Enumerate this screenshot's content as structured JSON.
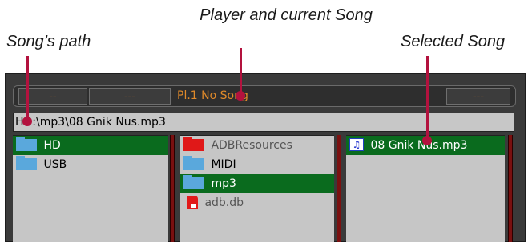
{
  "callouts": {
    "song_path": "Song’s path",
    "player_song": "Player and current Song",
    "selected_song": "Selected Song"
  },
  "player_bar": {
    "seg1": "--",
    "seg2": "---",
    "player_song_text": "Pl.1  No Song",
    "seg4": "---"
  },
  "path": "HD:\\mp3\\08 Gnik Nus.mp3",
  "left_panel": {
    "items": [
      {
        "label": "HD",
        "icon": "folder-icon",
        "selected": true
      },
      {
        "label": "USB",
        "icon": "folder-icon",
        "selected": false
      }
    ]
  },
  "middle_panel": {
    "items": [
      {
        "label": "ADBResources",
        "icon": "red-folder-icon",
        "selected": false
      },
      {
        "label": "MIDI",
        "icon": "folder-icon",
        "selected": false
      },
      {
        "label": "mp3",
        "icon": "folder-icon",
        "selected": true
      },
      {
        "label": "adb.db",
        "icon": "red-file-icon",
        "selected": false
      }
    ]
  },
  "right_panel": {
    "items": [
      {
        "label": "08 Gnik Nus.mp3",
        "icon": "music-note-icon",
        "selected": true
      }
    ]
  },
  "colors": {
    "selection": "#0a6b1e",
    "annotation": "#b3123e",
    "player_text": "#e08a2a",
    "divider": "#7a1010"
  }
}
